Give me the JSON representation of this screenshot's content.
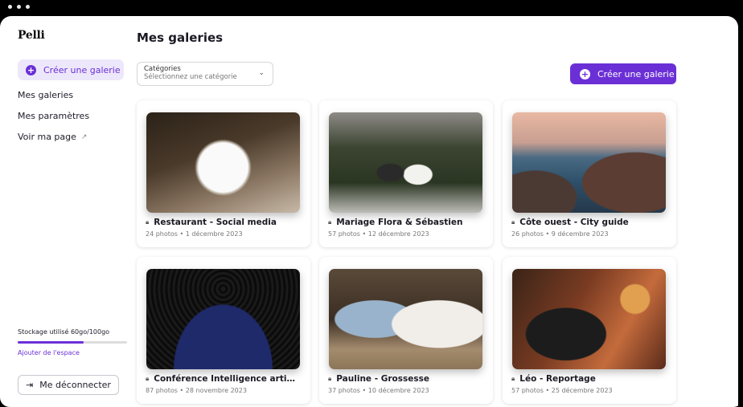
{
  "app": {
    "logo": "Pelli"
  },
  "sidebar": {
    "create_label": "Créer une galerie",
    "items": [
      {
        "label": "Mes galeries"
      },
      {
        "label": "Mes paramètres"
      },
      {
        "label": "Voir ma page"
      }
    ],
    "storage": {
      "label": "Stockage utilisé",
      "value": "60go/100go",
      "used_fraction": 0.6,
      "add_label": "Ajouter de l'espace"
    },
    "logout_label": "Me déconnecter"
  },
  "main": {
    "title": "Mes galeries",
    "category_select": {
      "label": "Catégories",
      "placeholder": "Sélectionnez une catégorie"
    },
    "create_label": "Créer une galerie",
    "galleries": [
      {
        "title": "Restaurant - Social media",
        "meta": "24 photos • 1 décembre 2023"
      },
      {
        "title": "Mariage Flora & Sébastien",
        "meta": "57 photos • 12 décembre 2023"
      },
      {
        "title": "Côte ouest - City guide",
        "meta": "26 photos • 9 décembre 2023"
      },
      {
        "title": "Conférence Intelligence artificiel...",
        "meta": "87 photos • 28 novembre 2023"
      },
      {
        "title": "Pauline - Grossesse",
        "meta": "37 photos • 10 décembre 2023"
      },
      {
        "title": "Léo - Reportage",
        "meta": "57 photos • 25 décembre 2023"
      }
    ]
  },
  "colors": {
    "accent": "#6b2fd6",
    "accent_light": "#ede7fb"
  },
  "icons": {
    "create": "plus-circle-icon",
    "external": "external-link-icon",
    "lock": "lock-icon",
    "chevron": "chevron-down-icon",
    "logout": "logout-icon"
  }
}
